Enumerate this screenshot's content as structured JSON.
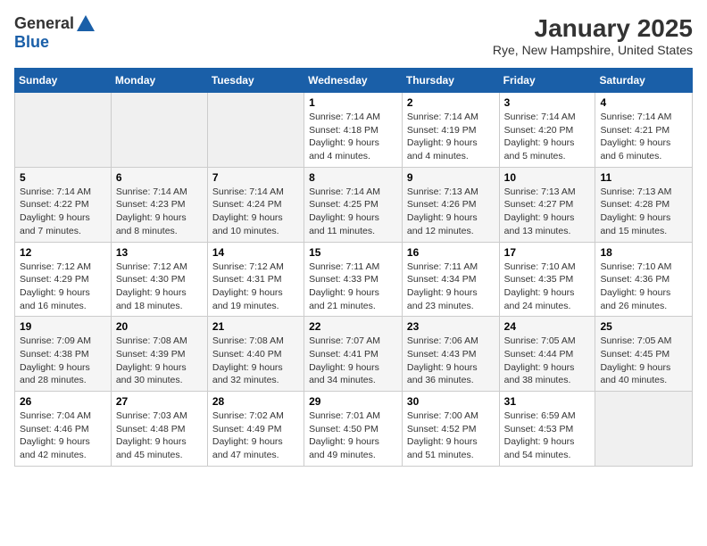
{
  "header": {
    "logo_general": "General",
    "logo_blue": "Blue",
    "title": "January 2025",
    "subtitle": "Rye, New Hampshire, United States"
  },
  "days_of_week": [
    "Sunday",
    "Monday",
    "Tuesday",
    "Wednesday",
    "Thursday",
    "Friday",
    "Saturday"
  ],
  "weeks": [
    [
      {
        "day": "",
        "info": ""
      },
      {
        "day": "",
        "info": ""
      },
      {
        "day": "",
        "info": ""
      },
      {
        "day": "1",
        "info": "Sunrise: 7:14 AM\nSunset: 4:18 PM\nDaylight: 9 hours and 4 minutes."
      },
      {
        "day": "2",
        "info": "Sunrise: 7:14 AM\nSunset: 4:19 PM\nDaylight: 9 hours and 4 minutes."
      },
      {
        "day": "3",
        "info": "Sunrise: 7:14 AM\nSunset: 4:20 PM\nDaylight: 9 hours and 5 minutes."
      },
      {
        "day": "4",
        "info": "Sunrise: 7:14 AM\nSunset: 4:21 PM\nDaylight: 9 hours and 6 minutes."
      }
    ],
    [
      {
        "day": "5",
        "info": "Sunrise: 7:14 AM\nSunset: 4:22 PM\nDaylight: 9 hours and 7 minutes."
      },
      {
        "day": "6",
        "info": "Sunrise: 7:14 AM\nSunset: 4:23 PM\nDaylight: 9 hours and 8 minutes."
      },
      {
        "day": "7",
        "info": "Sunrise: 7:14 AM\nSunset: 4:24 PM\nDaylight: 9 hours and 10 minutes."
      },
      {
        "day": "8",
        "info": "Sunrise: 7:14 AM\nSunset: 4:25 PM\nDaylight: 9 hours and 11 minutes."
      },
      {
        "day": "9",
        "info": "Sunrise: 7:13 AM\nSunset: 4:26 PM\nDaylight: 9 hours and 12 minutes."
      },
      {
        "day": "10",
        "info": "Sunrise: 7:13 AM\nSunset: 4:27 PM\nDaylight: 9 hours and 13 minutes."
      },
      {
        "day": "11",
        "info": "Sunrise: 7:13 AM\nSunset: 4:28 PM\nDaylight: 9 hours and 15 minutes."
      }
    ],
    [
      {
        "day": "12",
        "info": "Sunrise: 7:12 AM\nSunset: 4:29 PM\nDaylight: 9 hours and 16 minutes."
      },
      {
        "day": "13",
        "info": "Sunrise: 7:12 AM\nSunset: 4:30 PM\nDaylight: 9 hours and 18 minutes."
      },
      {
        "day": "14",
        "info": "Sunrise: 7:12 AM\nSunset: 4:31 PM\nDaylight: 9 hours and 19 minutes."
      },
      {
        "day": "15",
        "info": "Sunrise: 7:11 AM\nSunset: 4:33 PM\nDaylight: 9 hours and 21 minutes."
      },
      {
        "day": "16",
        "info": "Sunrise: 7:11 AM\nSunset: 4:34 PM\nDaylight: 9 hours and 23 minutes."
      },
      {
        "day": "17",
        "info": "Sunrise: 7:10 AM\nSunset: 4:35 PM\nDaylight: 9 hours and 24 minutes."
      },
      {
        "day": "18",
        "info": "Sunrise: 7:10 AM\nSunset: 4:36 PM\nDaylight: 9 hours and 26 minutes."
      }
    ],
    [
      {
        "day": "19",
        "info": "Sunrise: 7:09 AM\nSunset: 4:38 PM\nDaylight: 9 hours and 28 minutes."
      },
      {
        "day": "20",
        "info": "Sunrise: 7:08 AM\nSunset: 4:39 PM\nDaylight: 9 hours and 30 minutes."
      },
      {
        "day": "21",
        "info": "Sunrise: 7:08 AM\nSunset: 4:40 PM\nDaylight: 9 hours and 32 minutes."
      },
      {
        "day": "22",
        "info": "Sunrise: 7:07 AM\nSunset: 4:41 PM\nDaylight: 9 hours and 34 minutes."
      },
      {
        "day": "23",
        "info": "Sunrise: 7:06 AM\nSunset: 4:43 PM\nDaylight: 9 hours and 36 minutes."
      },
      {
        "day": "24",
        "info": "Sunrise: 7:05 AM\nSunset: 4:44 PM\nDaylight: 9 hours and 38 minutes."
      },
      {
        "day": "25",
        "info": "Sunrise: 7:05 AM\nSunset: 4:45 PM\nDaylight: 9 hours and 40 minutes."
      }
    ],
    [
      {
        "day": "26",
        "info": "Sunrise: 7:04 AM\nSunset: 4:46 PM\nDaylight: 9 hours and 42 minutes."
      },
      {
        "day": "27",
        "info": "Sunrise: 7:03 AM\nSunset: 4:48 PM\nDaylight: 9 hours and 45 minutes."
      },
      {
        "day": "28",
        "info": "Sunrise: 7:02 AM\nSunset: 4:49 PM\nDaylight: 9 hours and 47 minutes."
      },
      {
        "day": "29",
        "info": "Sunrise: 7:01 AM\nSunset: 4:50 PM\nDaylight: 9 hours and 49 minutes."
      },
      {
        "day": "30",
        "info": "Sunrise: 7:00 AM\nSunset: 4:52 PM\nDaylight: 9 hours and 51 minutes."
      },
      {
        "day": "31",
        "info": "Sunrise: 6:59 AM\nSunset: 4:53 PM\nDaylight: 9 hours and 54 minutes."
      },
      {
        "day": "",
        "info": ""
      }
    ]
  ]
}
